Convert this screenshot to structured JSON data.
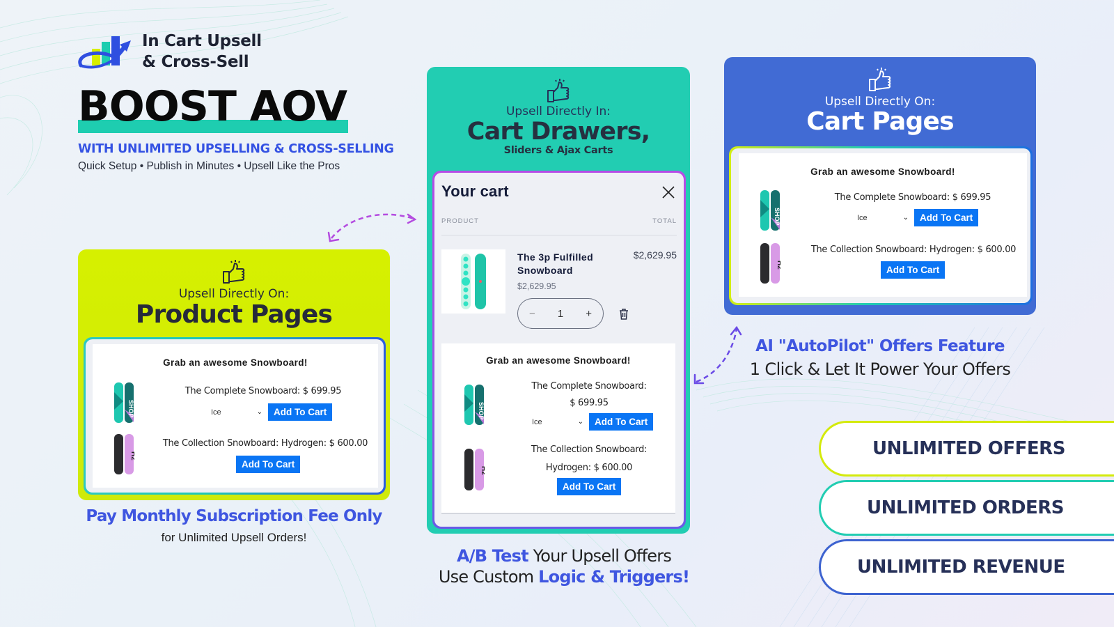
{
  "brand": {
    "name_line1": "In Cart Upsell",
    "name_line2": "& Cross-Sell",
    "logo_icon": "growth-chart-logo-icon"
  },
  "hero": {
    "headline": "BOOST AOV",
    "subhead": "WITH UNLIMITED UPSELLING & CROSS-SELLING",
    "tagline": "Quick Setup • Publish in Minutes • Upsell Like the Pros"
  },
  "colors": {
    "lime": "#d4ef00",
    "teal": "#22cdb2",
    "blue": "#416bd4",
    "accent_text": "#3f56e0",
    "button": "#0a75f4",
    "arrow_purple": "#b44ce0",
    "arrow_violet": "#6a4ae6"
  },
  "product_pages_card": {
    "kicker": "Upsell Directly On:",
    "title": "Product Pages",
    "icon": "thumbs-up-icon",
    "upsell": {
      "title": "Grab an awesome Snowboard!",
      "items": [
        {
          "name": "The Complete Snowboard: $ 699.95",
          "variant": "Ice",
          "button": "Add To Cart"
        },
        {
          "name": "The Collection Snowboard: Hydrogen: $ 600.00",
          "button": "Add To Cart"
        }
      ]
    }
  },
  "cart_drawer_card": {
    "kicker": "Upsell Directly In:",
    "title": "Cart Drawers,",
    "subtitle": "Sliders & Ajax Carts",
    "icon": "thumbs-up-icon",
    "cart": {
      "heading": "Your cart",
      "col_product": "PRODUCT",
      "col_total": "TOTAL",
      "line_item": {
        "name_line1": "The 3p Fulfilled",
        "name_line2": "Snowboard",
        "unit_price": "$2,629.95",
        "total": "$2,629.95",
        "quantity": "1",
        "decrement": "−",
        "increment": "+"
      }
    },
    "upsell": {
      "title": "Grab an awesome Snowboard!",
      "items": [
        {
          "name_line1": "The Complete Snowboard:",
          "name_line2": "$ 699.95",
          "variant": "Ice",
          "button": "Add To Cart"
        },
        {
          "name_line1": "The Collection Snowboard:",
          "name_line2": "Hydrogen: $ 600.00",
          "button": "Add To Cart"
        }
      ]
    }
  },
  "cart_pages_card": {
    "kicker": "Upsell Directly On:",
    "title": "Cart Pages",
    "icon": "thumbs-up-icon",
    "upsell": {
      "title": "Grab an awesome Snowboard!",
      "items": [
        {
          "name": "The Complete Snowboard: $ 699.95",
          "variant": "Ice",
          "button": "Add To Cart"
        },
        {
          "name": "The Collection Snowboard: Hydrogen: $ 600.00",
          "button": "Add To Cart"
        }
      ]
    }
  },
  "pricing_note": {
    "title": "Pay Monthly Subscription Fee Only",
    "subtitle": "for Unlimited Upsell Orders!"
  },
  "ab_test_note": {
    "line1_highlight": "A/B Test",
    "line1_rest": " Your Upsell Offers",
    "line2_prefix": "Use Custom ",
    "line2_highlight": "Logic & Triggers!"
  },
  "autopilot_note": {
    "title": "AI \"AutoPilot\" Offers Feature",
    "subtitle": "1 Click & Let It Power Your Offers"
  },
  "benefits": [
    {
      "label": "UNLIMITED OFFERS",
      "border": "#d4ea0c"
    },
    {
      "label": "UNLIMITED ORDERS",
      "border": "#22cdb2"
    },
    {
      "label": "UNLIMITED REVENUE",
      "border": "#3d63d0"
    }
  ]
}
